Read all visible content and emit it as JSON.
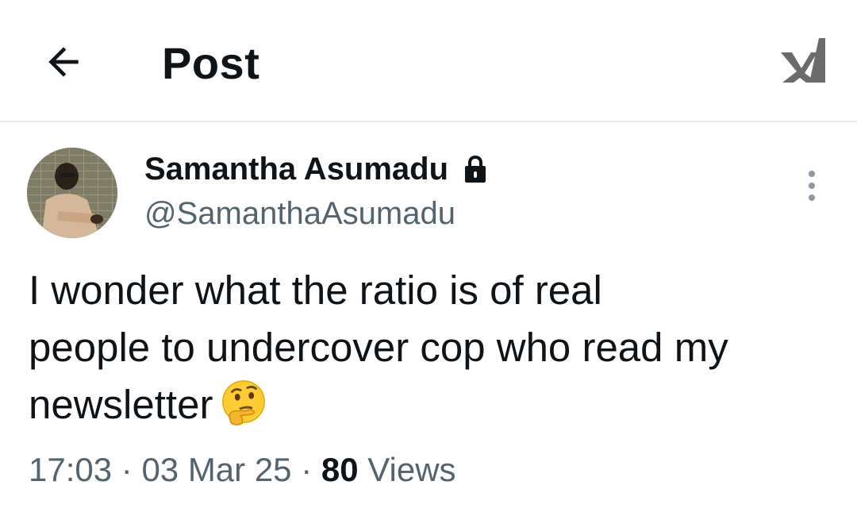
{
  "header": {
    "title": "Post",
    "back_icon": "arrow-left-icon",
    "logo_icon": "x-logo-icon"
  },
  "author": {
    "name": "Samantha Asumadu",
    "handle": "@SamanthaAsumadu",
    "protected_icon": "lock-icon",
    "avatar_icon": "avatar-photo",
    "more_icon": "more-vertical-icon"
  },
  "tweet": {
    "lines": [
      "I wonder what the ratio is of real",
      "people to undercover cop who read my",
      "newsletter"
    ],
    "emoji": "thinking-face-emoji"
  },
  "meta": {
    "time": "17:03",
    "separator": " · ",
    "date": "03 Mar 25",
    "views_count": "80",
    "views_label": " Views"
  },
  "colors": {
    "text_primary": "#0f1419",
    "text_secondary": "#536471",
    "divider": "#e7e9ea",
    "background": "#ffffff"
  }
}
